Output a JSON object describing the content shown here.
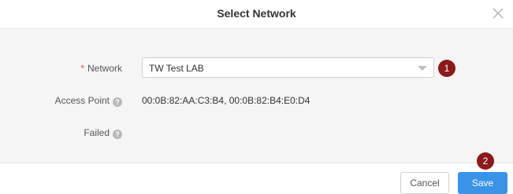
{
  "dialog": {
    "title": "Select Network"
  },
  "form": {
    "network": {
      "required_mark": "*",
      "label": "Network",
      "selected_value": "TW Test LAB"
    },
    "access_point": {
      "label": "Access Point",
      "help_icon": "?",
      "value": "00:0B:82:AA:C3:B4, 00:0B:82:B4:E0:D4"
    },
    "failed": {
      "label": "Failed",
      "help_icon": "?"
    }
  },
  "markers": {
    "first": "1",
    "second": "2"
  },
  "footer": {
    "cancel_label": "Cancel",
    "save_label": "Save"
  },
  "colors": {
    "accent": "#3a93e6",
    "marker": "#8b1a1a",
    "required": "#e64b4b"
  }
}
